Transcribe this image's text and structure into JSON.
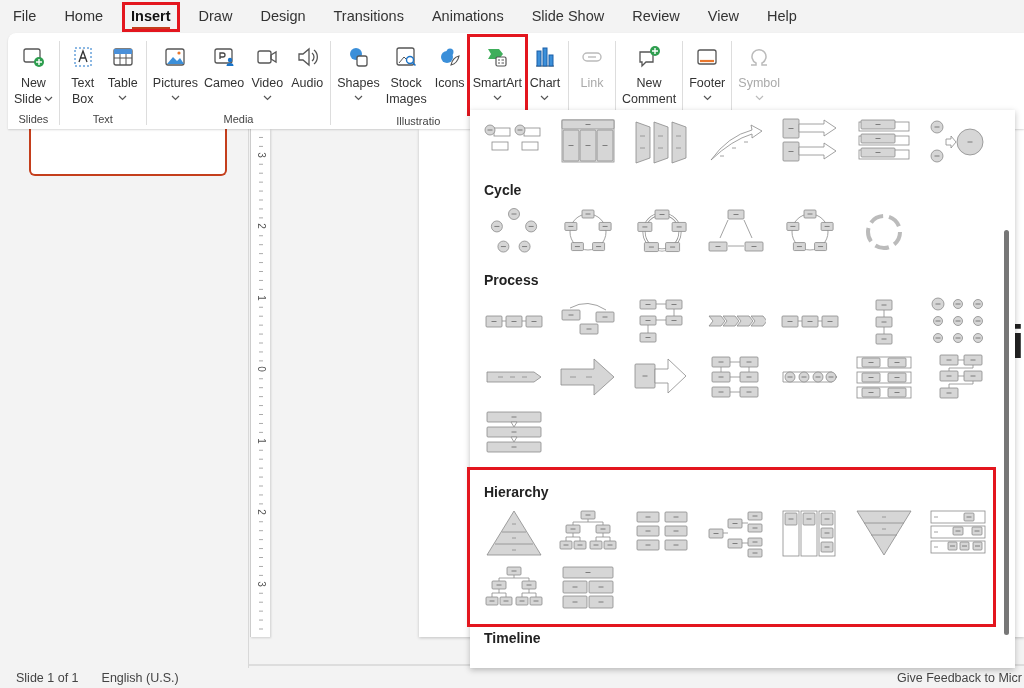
{
  "tabs": [
    {
      "label": "File",
      "selected": false,
      "highlighted": false
    },
    {
      "label": "Home",
      "selected": false,
      "highlighted": false
    },
    {
      "label": "Insert",
      "selected": true,
      "highlighted": true
    },
    {
      "label": "Draw",
      "selected": false,
      "highlighted": false
    },
    {
      "label": "Design",
      "selected": false,
      "highlighted": false
    },
    {
      "label": "Transitions",
      "selected": false,
      "highlighted": false
    },
    {
      "label": "Animations",
      "selected": false,
      "highlighted": false
    },
    {
      "label": "Slide Show",
      "selected": false,
      "highlighted": false
    },
    {
      "label": "Review",
      "selected": false,
      "highlighted": false
    },
    {
      "label": "View",
      "selected": false,
      "highlighted": false
    },
    {
      "label": "Help",
      "selected": false,
      "highlighted": false
    }
  ],
  "ribbon": {
    "groups": [
      {
        "label": "Slides",
        "buttons": [
          {
            "label": "New\nSlide",
            "dropdown": true,
            "inline_caret": true,
            "disabled": false,
            "highlighted": false
          }
        ]
      },
      {
        "label": "Text",
        "buttons": [
          {
            "label": "Text\nBox",
            "disabled": false,
            "highlighted": false
          },
          {
            "label": "Table",
            "dropdown": true,
            "disabled": false,
            "highlighted": false
          }
        ]
      },
      {
        "label": "Media",
        "buttons": [
          {
            "label": "Pictures",
            "dropdown": true,
            "disabled": false,
            "highlighted": false
          },
          {
            "label": "Cameo",
            "disabled": false,
            "highlighted": false
          },
          {
            "label": "Video",
            "dropdown": true,
            "disabled": false,
            "highlighted": false
          },
          {
            "label": "Audio",
            "disabled": false,
            "highlighted": false
          }
        ]
      },
      {
        "label": "Illustratio",
        "buttons": [
          {
            "label": "Shapes",
            "dropdown": true,
            "disabled": false,
            "highlighted": false
          },
          {
            "label": "Stock\nImages",
            "disabled": false,
            "highlighted": false
          },
          {
            "label": "Icons",
            "disabled": false,
            "highlighted": false
          },
          {
            "label": "SmartArt",
            "dropdown": true,
            "disabled": false,
            "highlighted": true
          },
          {
            "label": "Chart",
            "dropdown": true,
            "disabled": false,
            "highlighted": false
          }
        ]
      },
      {
        "buttons": [
          {
            "label": "Link",
            "disabled": true,
            "highlighted": false
          }
        ]
      },
      {
        "buttons": [
          {
            "label": "New\nComment",
            "disabled": false,
            "highlighted": false
          }
        ]
      },
      {
        "buttons": [
          {
            "label": "Footer",
            "dropdown": true,
            "disabled": false,
            "highlighted": false
          }
        ]
      },
      {
        "buttons": [
          {
            "label": "Symbol",
            "dropdown": true,
            "disabled": true,
            "highlighted": false
          }
        ]
      }
    ]
  },
  "thumbnails": [
    {
      "selected": true
    }
  ],
  "ruler": {
    "labels": [
      "3",
      "2",
      "1",
      "0",
      "1",
      "2",
      "3"
    ]
  },
  "slide": {
    "visible_text": "i"
  },
  "smartart_gallery": {
    "sections": [
      {
        "highlighted": false,
        "layouts": [
          {
            "kind": "circle-box-pairs"
          },
          {
            "kind": "table"
          },
          {
            "kind": "trapezoids"
          },
          {
            "kind": "curved-arrow"
          },
          {
            "kind": "box-arrows"
          },
          {
            "kind": "stacked-bars"
          },
          {
            "kind": "circle-merge"
          }
        ]
      },
      {
        "title": "Cycle",
        "highlighted": false,
        "layouts": [
          {
            "kind": "circle-ring"
          },
          {
            "kind": "box-ring"
          },
          {
            "kind": "box-ring-thick"
          },
          {
            "kind": "triangle-arrows"
          },
          {
            "kind": "box-ring"
          },
          {
            "kind": "arrow-ring"
          }
        ]
      },
      {
        "title": "Process",
        "highlighted": false,
        "layouts": [
          {
            "kind": "box-chain"
          },
          {
            "kind": "box-loop"
          },
          {
            "kind": "box-zigzag"
          },
          {
            "kind": "chevrons"
          },
          {
            "kind": "box-chain"
          },
          {
            "kind": "box-column"
          },
          {
            "kind": "circle-grid"
          },
          {
            "kind": "arrow-bar"
          },
          {
            "kind": "big-arrow"
          },
          {
            "kind": "arrow-box"
          },
          {
            "kind": "box-grid"
          },
          {
            "kind": "circle-chain"
          },
          {
            "kind": "box-rows"
          },
          {
            "kind": "staircase"
          },
          {
            "kind": "stacked-rows"
          }
        ]
      },
      {
        "title": "Hierarchy",
        "highlighted": true,
        "layouts": [
          {
            "kind": "pyramid"
          },
          {
            "kind": "org-chart"
          },
          {
            "kind": "box-pairs"
          },
          {
            "kind": "tree-horizontal"
          },
          {
            "kind": "box-columns"
          },
          {
            "kind": "inverted-pyramid"
          },
          {
            "kind": "labeled-tree"
          },
          {
            "kind": "org-chart"
          },
          {
            "kind": "box-table"
          }
        ]
      },
      {
        "title": "Timeline",
        "highlighted": false
      }
    ]
  },
  "status_bar": {
    "slide_position": "Slide 1 of 1",
    "language": "English (U.S.)",
    "feedback": "Give Feedback to Micr"
  }
}
